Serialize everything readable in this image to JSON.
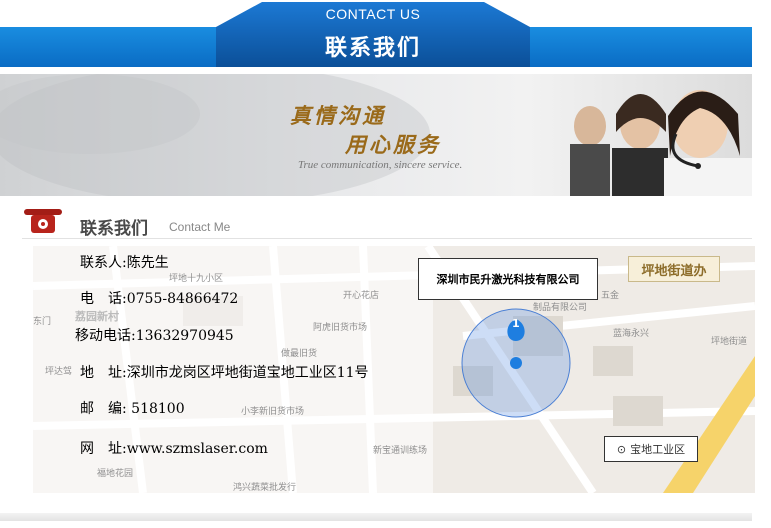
{
  "header": {
    "title_en": "CONTACT US",
    "title_zh": "联系我们"
  },
  "banner": {
    "slogan_line1": "真情沟通",
    "slogan_line2": "用心服务",
    "slogan_en": "True communication, sincere service."
  },
  "section": {
    "title_zh": "联系我们",
    "title_en": "Contact Me",
    "icon": "telephone-icon"
  },
  "contact": {
    "person": "联系人:陈先生",
    "phone": "电　话:0755-84866472",
    "mobile": "移动电话:13632970945",
    "address": "地　址:深圳市龙岗区坪地街道宝地工业区11号",
    "postcode": "邮　编: 518100",
    "website": "网　址:www.szmslaser.com"
  },
  "map": {
    "company_label": "深圳市民升激光科技有限公司",
    "street_label": "坪地街道办",
    "industrial_label": "宝地工业区",
    "marker_number": "1",
    "labels": {
      "l1": "坪地十九小区",
      "l2": "开心花店",
      "l3": "荔园新村",
      "l4": "阿虎旧货市场",
      "l5": "做最旧货",
      "l6": "坪达驾",
      "l7": "小李新旧货市场",
      "l8": "新宝通训练场",
      "l9": "福地花园",
      "l10": "鸿兴蔬菜批发行",
      "l11": "五金",
      "l12": "制品有限公司",
      "l13": "蓝海永兴",
      "l14": "坪地街道",
      "l15": "东门"
    }
  },
  "colors": {
    "header_blue": "#0a6cc4",
    "header_dark": "#0b5ea8",
    "street_text": "#8d6d2a",
    "marker_blue": "#1e7ee0"
  }
}
